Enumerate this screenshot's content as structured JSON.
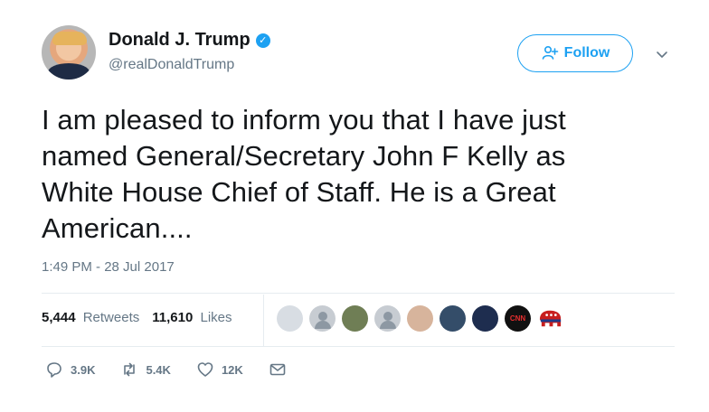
{
  "user": {
    "display_name": "Donald J. Trump",
    "handle": "@realDonaldTrump",
    "verified_mark": "✓"
  },
  "header": {
    "follow_label": "Follow",
    "follow_icon": "person-plus-icon",
    "menu_icon": "chevron-down-icon"
  },
  "tweet": {
    "text": "I am pleased to inform you that I have just\nnamed General/Secretary John F Kelly as\nWhite House Chief of Staff. He is a Great\nAmerican....",
    "timestamp": "1:49 PM - 28 Jul 2017"
  },
  "stats": {
    "retweets_count": "5,444",
    "retweets_label": "Retweets",
    "likes_count": "11,610",
    "likes_label": "Likes"
  },
  "liker_avatars": [
    {
      "label": "",
      "color": "#d8dde3"
    },
    {
      "label": "",
      "color": "#c7ccd2"
    },
    {
      "label": "",
      "color": "#6f7e55"
    },
    {
      "label": "",
      "color": "#c7ccd2"
    },
    {
      "label": "",
      "color": "#d7b49c"
    },
    {
      "label": "",
      "color": "#344d69"
    },
    {
      "label": "",
      "color": "#1e2d4f"
    },
    {
      "label": "CNN",
      "color": "#111111"
    },
    {
      "label": "",
      "color": "#c81e1e"
    }
  ],
  "actions": {
    "reply_count": "3.9K",
    "retweet_count": "5.4K",
    "like_count": "12K",
    "message_icon": "envelope-icon"
  },
  "colors": {
    "accent": "#1da1f2",
    "text": "#14171a",
    "secondary_text": "#657786",
    "divider": "#e6ecf0"
  }
}
